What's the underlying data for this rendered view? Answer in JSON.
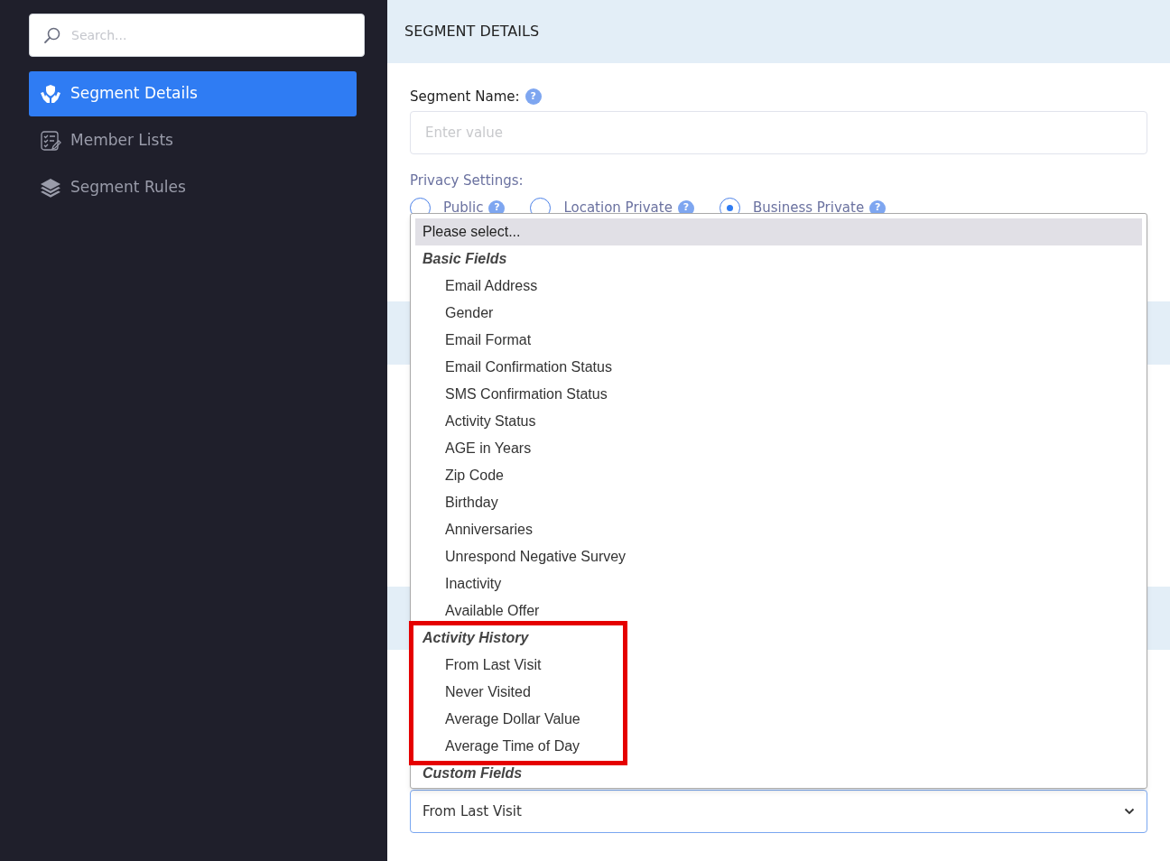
{
  "sidebar": {
    "search": {
      "placeholder": "Search..."
    },
    "items": [
      {
        "label": "Segment Details",
        "selected": true
      },
      {
        "label": "Member Lists",
        "selected": false
      },
      {
        "label": "Segment Rules",
        "selected": false
      }
    ]
  },
  "main": {
    "title": "SEGMENT DETAILS",
    "segment_name": {
      "label": "Segment Name:",
      "help": "?",
      "placeholder": "Enter value"
    },
    "privacy": {
      "label": "Privacy Settings:",
      "options": [
        {
          "label": "Public",
          "help": "?",
          "selected": false
        },
        {
          "label": "Location Private",
          "help": "?",
          "selected": false
        },
        {
          "label": "Business Private",
          "help": "?",
          "selected": true
        }
      ]
    },
    "dropdown": {
      "first_option": {
        "label": "Please select...",
        "highlighted": true
      },
      "groups": [
        {
          "label": "Basic Fields",
          "annotated": false,
          "options": [
            "Email Address",
            "Gender",
            "Email Format",
            "Email Confirmation Status",
            "SMS Confirmation Status",
            "Activity Status",
            "AGE in Years",
            "Zip Code",
            "Birthday",
            "Anniversaries",
            "Unrespond Negative Survey",
            "Inactivity",
            "Available Offer"
          ]
        },
        {
          "label": "Activity History",
          "annotated": true,
          "options": [
            "From Last Visit",
            "Never Visited",
            "Average Dollar Value",
            "Average Time of Day"
          ]
        },
        {
          "label": "Custom Fields",
          "annotated": false
        }
      ]
    },
    "select": {
      "value": "From Last Visit"
    }
  }
}
